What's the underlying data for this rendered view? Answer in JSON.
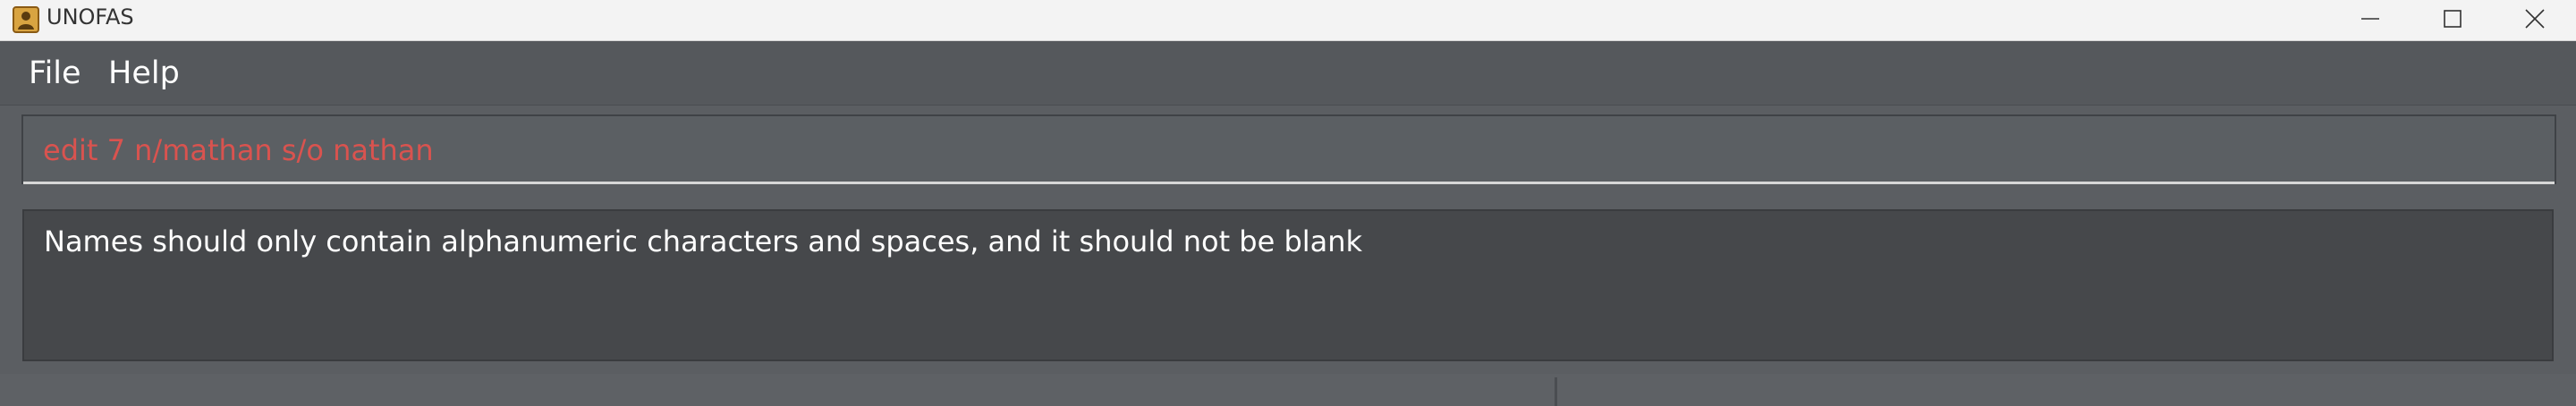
{
  "window": {
    "title": "UNOFAS",
    "icon": "app-person-icon",
    "controls": [
      "minimize-icon",
      "maximize-icon",
      "close-icon"
    ]
  },
  "menu": {
    "items": [
      {
        "label": "File"
      },
      {
        "label": "Help"
      }
    ]
  },
  "command": {
    "value": "edit 7 n/mathan s/o nathan",
    "error_color": "#d9534f"
  },
  "result": {
    "message": "Names should only contain alphanumeric characters and spaces, and it should not be blank"
  }
}
